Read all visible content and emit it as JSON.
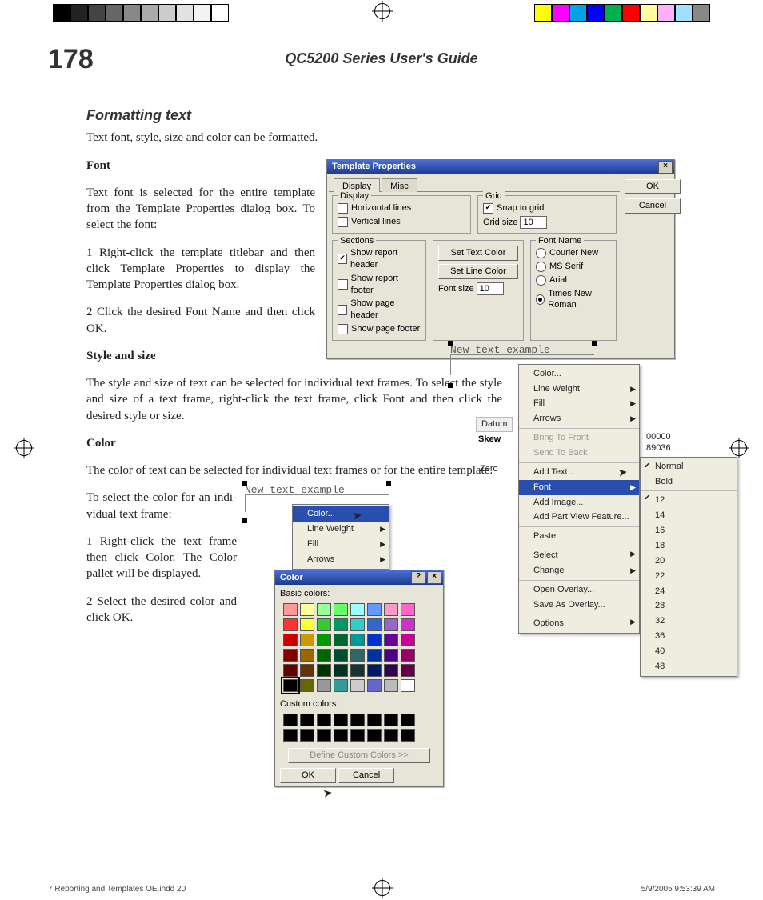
{
  "page_number": "178",
  "running_head": "QC5200 Series User's Guide",
  "section_heading": "Formatting text",
  "intro": "Text font, style, size and color can be formatted.",
  "font_h": "Font",
  "font_p1": "Text font is selected for the entire tem­plate from the Template Properties dia­log box.  To select the font:",
  "font_s1": "1     Right-click the template titlebar and then click Template Properties to display the Template Properties dialog box.",
  "font_s2": "2    Click the desired Font Name and then click OK.",
  "style_h": "Style and size",
  "style_p1": "The style and size of text can be selected for individual text frames.  To select the style and size of a text frame, right-click the text frame, click Font and then click the desired style or size.",
  "color_h": "Color",
  "color_p1": "The color of text can be selected for individual text frames or for the entire template.",
  "color_p2": "To select the color for an indi­vidual text frame:",
  "color_s1": "1    Right-click the text frame then click Color.  The Color pallet will be displayed.",
  "color_s2": "2     Select the desired color and click OK.",
  "text_example": "New text example",
  "tp": {
    "title": "Template Properties",
    "ok": "OK",
    "cancel": "Cancel",
    "tabs": {
      "display": "Display",
      "misc": "Misc"
    },
    "display_grp": "Display",
    "display_h": "Horizontal lines",
    "display_v": "Vertical lines",
    "grid_grp": "Grid",
    "grid_snap": "Snap to grid",
    "grid_size_lbl": "Grid size",
    "grid_size_val": "10",
    "sections_grp": "Sections",
    "sec_rh": "Show report header",
    "sec_rf": "Show report footer",
    "sec_ph": "Show page header",
    "sec_pf": "Show page footer",
    "set_text": "Set Text Color",
    "set_line": "Set Line Color",
    "fontsize_lbl": "Font size",
    "fontsize_val": "10",
    "fontname_grp": "Font Name",
    "fn_courier": "Courier New",
    "fn_msserif": "MS Serif",
    "fn_arial": "Arial",
    "fn_times": "Times New Roman"
  },
  "ctx": {
    "color": "Color...",
    "lineweight": "Line Weight",
    "fill": "Fill",
    "arrows": "Arrows",
    "bring": "Bring To Front",
    "send": "Send To Back",
    "addtext": "Add Text...",
    "font": "Font",
    "addimage": "Add Image...",
    "addpart": "Add Part View Feature...",
    "paste": "Paste",
    "select": "Select",
    "change": "Change",
    "openov": "Open Overlay...",
    "saveov": "Save As Overlay...",
    "options": "Options"
  },
  "fontmenu": {
    "normal": "Normal",
    "bold": "Bold",
    "sizes": [
      "12",
      "14",
      "16",
      "18",
      "20",
      "22",
      "24",
      "28",
      "32",
      "36",
      "40",
      "48"
    ]
  },
  "side_labels": {
    "datum": "Datum",
    "skew": "Skew",
    "zero": "Zero",
    "v1": "00000",
    "v2": "89036"
  },
  "color_dlg": {
    "title": "Color",
    "basic": "Basic colors:",
    "custom": "Custom colors:",
    "define": "Define Custom Colors >>",
    "ok": "OK",
    "cancel": "Cancel",
    "basic_colors": [
      "#ff9999",
      "#ffff99",
      "#99ff99",
      "#66ff66",
      "#99ffff",
      "#6699ff",
      "#ff99cc",
      "#ff66cc",
      "#ff3333",
      "#ffff33",
      "#33cc33",
      "#009966",
      "#33cccc",
      "#3366cc",
      "#9966cc",
      "#cc33cc",
      "#cc0000",
      "#cc9900",
      "#009900",
      "#006633",
      "#009999",
      "#0033cc",
      "#660099",
      "#cc0099",
      "#800000",
      "#996600",
      "#006600",
      "#004d33",
      "#336666",
      "#003399",
      "#4d0080",
      "#990066",
      "#660000",
      "#663300",
      "#003300",
      "#003322",
      "#1a3333",
      "#001a66",
      "#33004d",
      "#660044",
      "#000000",
      "#666600",
      "#999999",
      "#339999",
      "#cccccc",
      "#6666cc",
      "#bbbbbb",
      "#ffffff"
    ]
  },
  "footer": {
    "left": "7 Reporting and Templates OE.indd   20",
    "right": "5/9/2005   9:53:39 AM"
  }
}
